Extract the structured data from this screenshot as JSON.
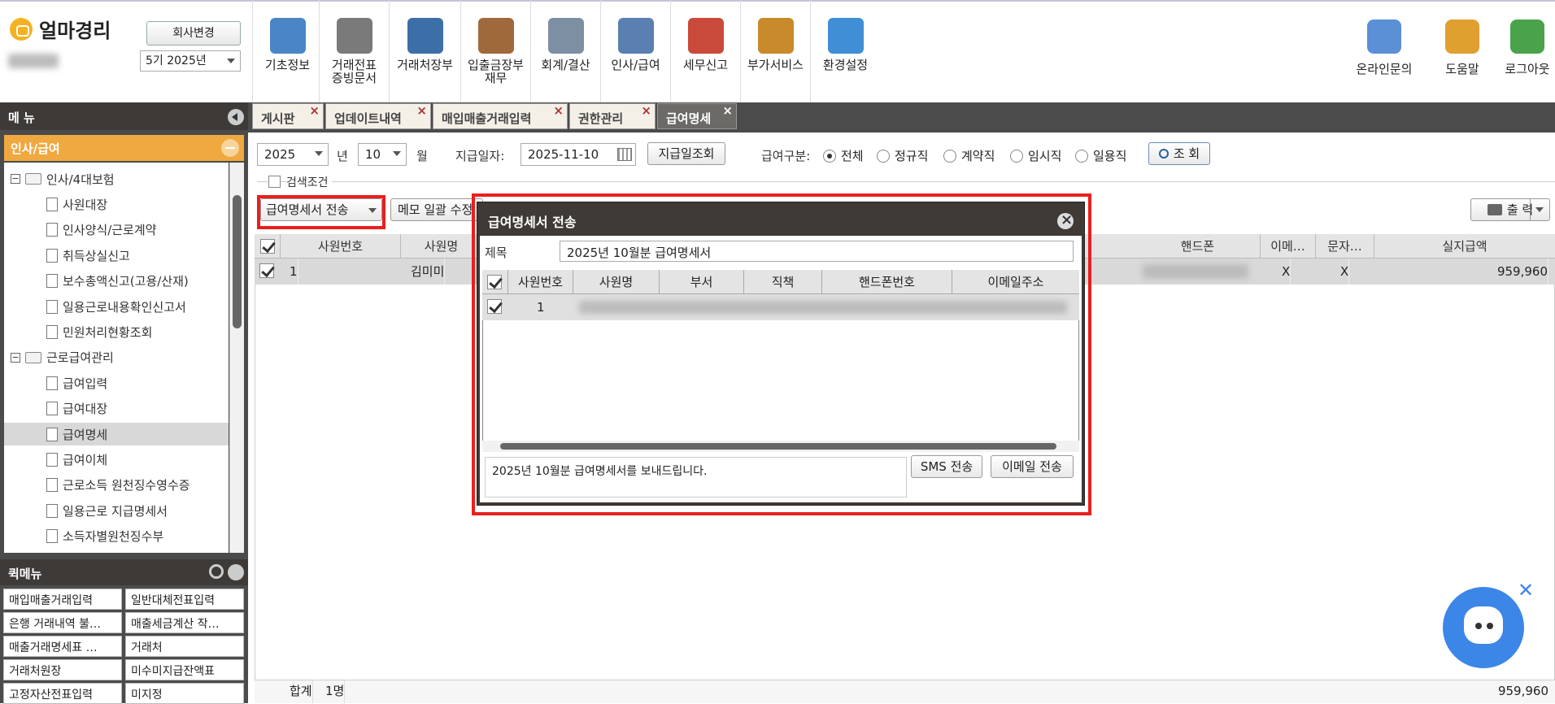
{
  "app": {
    "logo_text": "얼마경리",
    "company_btn": "회사변경",
    "period": "5기 2025년"
  },
  "top_menu": [
    {
      "label": "기초정보",
      "icon": "basic-info-icon"
    },
    {
      "label": "거래전표\n증빙문서",
      "icon": "voucher-icon"
    },
    {
      "label": "거래처장부",
      "icon": "ledger-icon"
    },
    {
      "label": "입출금장부\n재무",
      "icon": "money-bag-icon"
    },
    {
      "label": "회계/결산",
      "icon": "calculator-icon"
    },
    {
      "label": "인사/급여",
      "icon": "employee-icon"
    },
    {
      "label": "세무신고",
      "icon": "tax-icon"
    },
    {
      "label": "부가서비스",
      "icon": "bank-icon"
    },
    {
      "label": "환경설정",
      "icon": "gear-icon"
    }
  ],
  "top_right": [
    {
      "label": "온라인문의",
      "icon": "as-icon"
    },
    {
      "label": "도움말",
      "icon": "help-book-icon"
    },
    {
      "label": "로그아웃",
      "icon": "logout-icon"
    }
  ],
  "sidebar": {
    "title": "메 뉴",
    "section": "인사/급여",
    "tree": [
      {
        "label": "인사/4대보험",
        "type": "folder",
        "level": 0
      },
      {
        "label": "사원대장",
        "type": "doc",
        "level": 1
      },
      {
        "label": "인사양식/근로계약",
        "type": "doc",
        "level": 1
      },
      {
        "label": "취득상실신고",
        "type": "doc",
        "level": 1
      },
      {
        "label": "보수총액신고(고용/산재)",
        "type": "doc",
        "level": 1
      },
      {
        "label": "일용근로내용확인신고서",
        "type": "doc",
        "level": 1
      },
      {
        "label": "민원처리현황조회",
        "type": "doc",
        "level": 1
      },
      {
        "label": "근로급여관리",
        "type": "folder",
        "level": 0
      },
      {
        "label": "급여입력",
        "type": "doc",
        "level": 1
      },
      {
        "label": "급여대장",
        "type": "doc",
        "level": 1
      },
      {
        "label": "급여명세",
        "type": "doc",
        "level": 1,
        "selected": true
      },
      {
        "label": "급여이체",
        "type": "doc",
        "level": 1
      },
      {
        "label": "근로소득 원천징수영수증",
        "type": "doc",
        "level": 1
      },
      {
        "label": "일용근로 지급명세서",
        "type": "doc",
        "level": 1
      },
      {
        "label": "소득자별원천징수부",
        "type": "doc",
        "level": 1
      }
    ],
    "quick_title": "퀵메뉴",
    "quick": [
      "매입매출거래입력",
      "일반대체전표입력",
      "은행 거래내역 불…",
      "매출세금계산 작…",
      "매출거래명세표 …",
      "거래처",
      "거래처원장",
      "미수미지급잔액표",
      "고정자산전표입력",
      "미지정"
    ]
  },
  "tabs": [
    {
      "label": "게시판"
    },
    {
      "label": "업데이트내역"
    },
    {
      "label": "매입매출거래입력"
    },
    {
      "label": "권한관리"
    },
    {
      "label": "급여명세",
      "active": true
    }
  ],
  "filters": {
    "year": "2025",
    "year_unit": "년",
    "month": "10",
    "month_unit": "월",
    "pay_date_label": "지급일자:",
    "pay_date": "2025-11-10",
    "pay_date_btn": "지급일조회",
    "type_label": "급여구분:",
    "types": [
      "전체",
      "정규직",
      "계약직",
      "임시직",
      "일용직"
    ],
    "search_btn": "조 회",
    "search_cond": "검색조건"
  },
  "toolbar": {
    "send_btn": "급여명세서 전송",
    "memo_btn": "메모 일괄 수정",
    "print_btn": "출 력"
  },
  "grid": {
    "columns": [
      "사원번호",
      "사원명",
      "핸드폰",
      "이메…",
      "문자…",
      "실지급액"
    ],
    "rows": [
      {
        "no": "1",
        "name": "김미미",
        "email": "X",
        "sms": "X",
        "amount": "959,960"
      }
    ],
    "footer": {
      "label": "합계",
      "count": "1명",
      "amount": "959,960"
    }
  },
  "dialog": {
    "title": "급여명세서 전송",
    "subject_label": "제목",
    "subject": "2025년 10월분 급여명세서",
    "columns": [
      "사원번호",
      "사원명",
      "부서",
      "직책",
      "핸드폰번호",
      "이메일주소"
    ],
    "rows": [
      {
        "no": "1"
      }
    ],
    "message": "2025년 10월분 급여명세서를 보내드립니다.",
    "sms_btn": "SMS 전송",
    "email_btn": "이메일 전송"
  }
}
